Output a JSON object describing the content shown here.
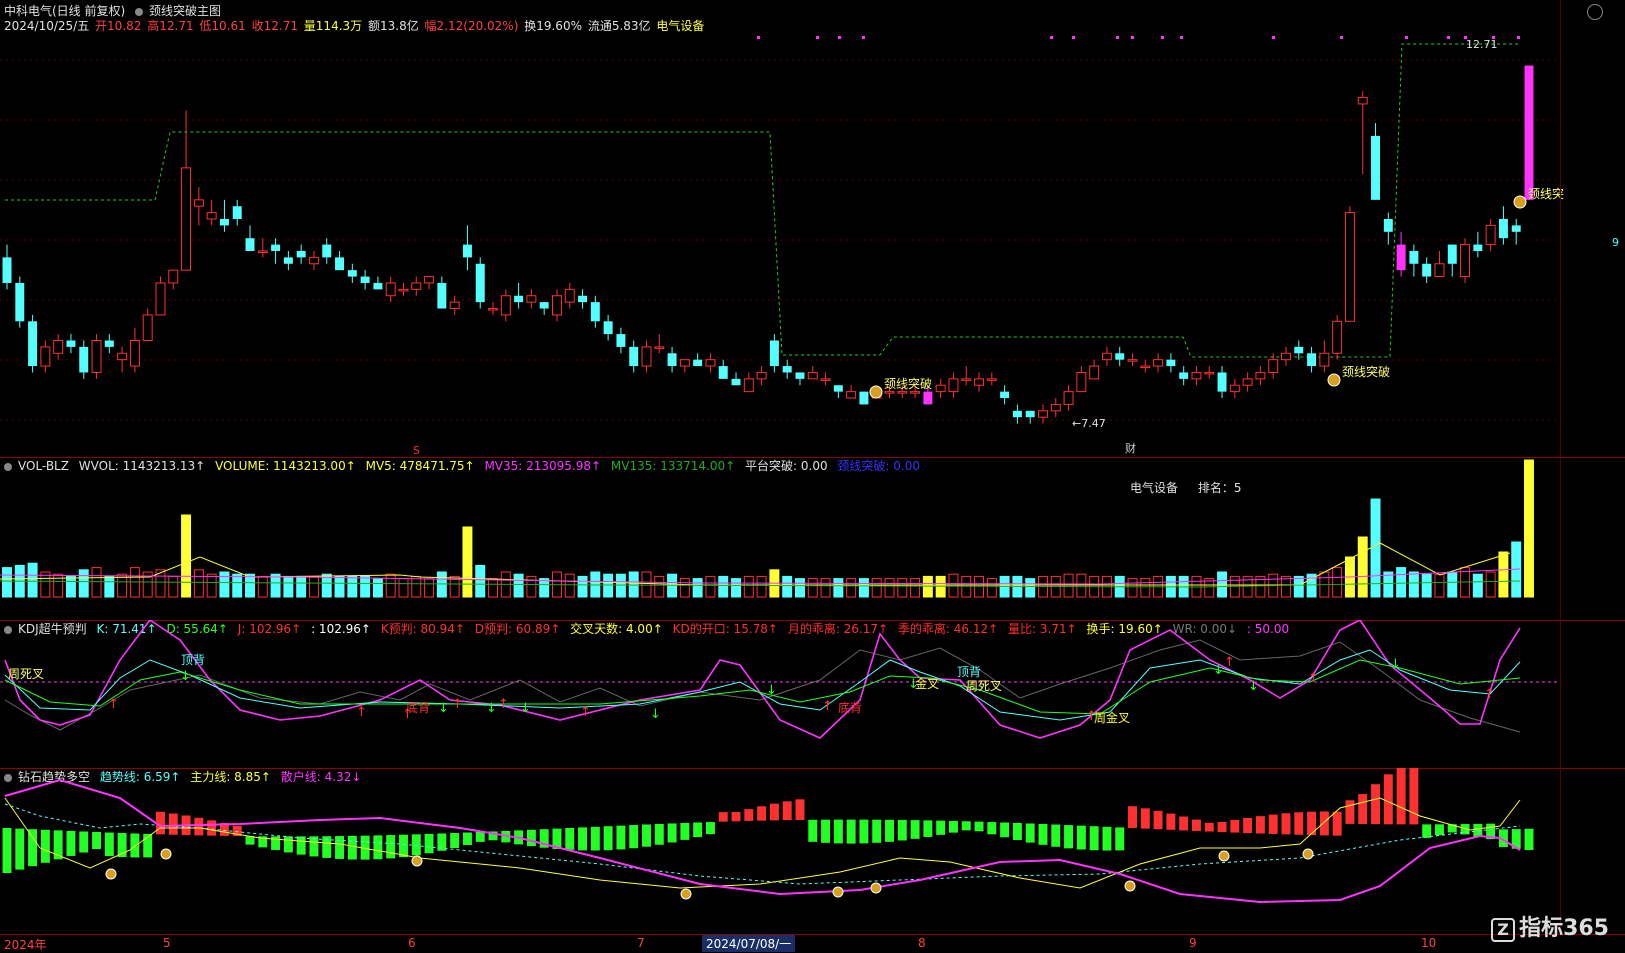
{
  "main": {
    "title": "中科电气(日线 前复权)",
    "indicator": "颈线突破主图",
    "info": {
      "date": "2024/10/25/五",
      "open": "开10.82",
      "high": "高12.71",
      "low": "低10.61",
      "close": "收12.71",
      "volume": "量114.3万",
      "amount": "额13.8亿",
      "change": "幅2.12(20.02%)",
      "turnover": "换19.60%",
      "float": "流通5.83亿",
      "industry": "电气设备"
    },
    "max_label": "12.71",
    "min_label": "←7.47",
    "signal_label": "颈线突破",
    "signal_label_short": "颈线突",
    "cai_label": "财",
    "s_label": "S",
    "right_edge_label": "9"
  },
  "volume": {
    "name": "VOL-BLZ",
    "wvol": "WVOL: 1143213.13↑",
    "volume": "VOLUME: 1143213.00↑",
    "mv5": "MV5: 478471.75↑",
    "mv35": "MV35: 213095.98↑",
    "mv135": "MV135: 133714.00↑",
    "platform": "平台突破: 0.00",
    "neck": "颈线突破: 0.00",
    "sector": "电气设备",
    "rank": "排名：5"
  },
  "kdj": {
    "name": "KDJ超牛预判",
    "k": "K: 71.41↑",
    "d": "D: 55.64↑",
    "j": "J: 102.96↑",
    "j2": ": 102.96↑",
    "kpred": "K预判: 80.94↑",
    "dpred": "D预判: 60.89↑",
    "cross_days": "交叉天数: 4.00↑",
    "kd_open": "KD的开口: 15.78↑",
    "month_dist": "月的乖离: 26.17↑",
    "season_dist": "季的乖离: 46.12↑",
    "vol_ratio": "量比: 3.71↑",
    "turnover": "换手: 19.60↑",
    "wr": "WR: 0.00↓",
    "fifty": ": 50.00",
    "labels": {
      "week_dead": "周死叉",
      "top_div": "顶背",
      "bottom_div": "底背",
      "golden": "金叉",
      "week_golden": "周金叉"
    }
  },
  "trend": {
    "name": "钻石趋势多空",
    "trend_line": "趋势线: 6.59↑",
    "main_line": "主力线: 8.85↑",
    "retail_line": "散户线: 4.32↓"
  },
  "xaxis": {
    "ticks": [
      "2024年",
      "5",
      "6",
      "7",
      "8",
      "9",
      "10"
    ],
    "selected": "2024/07/08/一"
  },
  "logo": "指标365",
  "colors": {
    "up": "#ff3030",
    "down": "#54ffff",
    "magenta": "#ff33ff",
    "yellow": "#ffff33",
    "green": "#22ff22",
    "neck": "#22cc22"
  },
  "chart_data": {
    "type": "candlestick",
    "ylim": [
      7.0,
      13.1
    ],
    "candles": [
      [
        9.7,
        9.3,
        9.9,
        9.2
      ],
      [
        9.3,
        8.7,
        9.4,
        8.6
      ],
      [
        8.7,
        8.0,
        8.8,
        7.9
      ],
      [
        8.0,
        8.3,
        8.4,
        7.9
      ],
      [
        8.2,
        8.4,
        8.5,
        8.1
      ],
      [
        8.4,
        8.3,
        8.5,
        8.2
      ],
      [
        8.3,
        7.9,
        8.4,
        7.8
      ],
      [
        7.9,
        8.4,
        8.5,
        7.8
      ],
      [
        8.4,
        8.3,
        8.5,
        8.2
      ],
      [
        8.1,
        8.2,
        8.3,
        7.9
      ],
      [
        8.0,
        8.4,
        8.6,
        7.9
      ],
      [
        8.4,
        8.8,
        8.9,
        8.4
      ],
      [
        8.8,
        9.3,
        9.4,
        8.8
      ],
      [
        9.3,
        9.5,
        9.5,
        9.2
      ],
      [
        9.5,
        11.1,
        12.0,
        10.4
      ],
      [
        10.5,
        10.6,
        10.8,
        10.2
      ],
      [
        10.3,
        10.4,
        10.6,
        10.2
      ],
      [
        10.3,
        10.2,
        10.6,
        10.1
      ],
      [
        10.5,
        10.3,
        10.6,
        10.2
      ],
      [
        10.0,
        9.8,
        10.2,
        9.8
      ],
      [
        9.8,
        9.8,
        10.0,
        9.7
      ],
      [
        9.9,
        9.8,
        10.0,
        9.6
      ],
      [
        9.7,
        9.6,
        9.8,
        9.5
      ],
      [
        9.8,
        9.7,
        9.9,
        9.6
      ],
      [
        9.6,
        9.7,
        9.8,
        9.5
      ],
      [
        9.9,
        9.7,
        10.0,
        9.6
      ],
      [
        9.7,
        9.5,
        9.8,
        9.5
      ],
      [
        9.5,
        9.4,
        9.6,
        9.3
      ],
      [
        9.4,
        9.3,
        9.5,
        9.2
      ],
      [
        9.3,
        9.2,
        9.4,
        9.2
      ],
      [
        9.1,
        9.3,
        9.4,
        9.0
      ],
      [
        9.2,
        9.2,
        9.3,
        9.1
      ],
      [
        9.2,
        9.3,
        9.4,
        9.1
      ],
      [
        9.3,
        9.4,
        9.4,
        9.2
      ],
      [
        9.3,
        8.9,
        9.4,
        8.9
      ],
      [
        8.9,
        9.0,
        9.1,
        8.8
      ],
      [
        9.9,
        9.7,
        10.2,
        9.5
      ],
      [
        9.6,
        9.0,
        9.7,
        8.9
      ],
      [
        8.9,
        8.9,
        9.0,
        8.8
      ],
      [
        8.8,
        9.1,
        9.2,
        8.7
      ],
      [
        9.1,
        9.0,
        9.3,
        8.9
      ],
      [
        9.0,
        9.1,
        9.2,
        8.9
      ],
      [
        9.0,
        8.9,
        9.0,
        8.8
      ],
      [
        8.8,
        9.1,
        9.2,
        8.7
      ],
      [
        9.0,
        9.2,
        9.3,
        8.9
      ],
      [
        9.1,
        9.0,
        9.2,
        8.9
      ],
      [
        9.0,
        8.7,
        9.1,
        8.6
      ],
      [
        8.7,
        8.5,
        8.8,
        8.4
      ],
      [
        8.5,
        8.3,
        8.6,
        8.2
      ],
      [
        8.3,
        8.0,
        8.4,
        7.9
      ],
      [
        8.0,
        8.3,
        8.4,
        7.9
      ],
      [
        8.3,
        8.3,
        8.5,
        8.2
      ],
      [
        8.2,
        8.0,
        8.3,
        7.9
      ],
      [
        8.0,
        8.1,
        8.1,
        7.9
      ],
      [
        8.1,
        8.0,
        8.2,
        8.0
      ],
      [
        8.0,
        8.1,
        8.2,
        7.9
      ],
      [
        8.0,
        7.8,
        8.1,
        7.8
      ],
      [
        7.8,
        7.7,
        7.9,
        7.7
      ],
      [
        7.6,
        7.8,
        7.9,
        7.6
      ],
      [
        7.8,
        7.9,
        8.0,
        7.7
      ],
      [
        8.4,
        8.0,
        8.5,
        7.9
      ],
      [
        8.0,
        7.9,
        8.1,
        7.8
      ],
      [
        7.9,
        7.8,
        7.9,
        7.7
      ],
      [
        7.8,
        7.9,
        8.0,
        7.8
      ],
      [
        7.8,
        7.8,
        7.9,
        7.7
      ],
      [
        7.7,
        7.6,
        7.7,
        7.5
      ],
      [
        7.5,
        7.6,
        7.7,
        7.5
      ],
      [
        7.6,
        7.4,
        7.6,
        7.4
      ],
      [
        7.5,
        7.6,
        7.7,
        7.5
      ],
      [
        7.6,
        7.6,
        7.7,
        7.5
      ],
      [
        7.6,
        7.6,
        7.7,
        7.5
      ],
      [
        7.6,
        7.6,
        7.7,
        7.5
      ],
      [
        7.4,
        7.6,
        7.7,
        7.4
      ],
      [
        7.6,
        7.7,
        7.8,
        7.5
      ],
      [
        7.6,
        7.8,
        7.9,
        7.5
      ],
      [
        7.8,
        7.8,
        8.0,
        7.7
      ],
      [
        7.7,
        7.8,
        7.9,
        7.6
      ],
      [
        7.8,
        7.8,
        7.9,
        7.7
      ],
      [
        7.6,
        7.5,
        7.7,
        7.4
      ],
      [
        7.3,
        7.2,
        7.4,
        7.1
      ],
      [
        7.3,
        7.2,
        7.3,
        7.1
      ],
      [
        7.2,
        7.3,
        7.4,
        7.1
      ],
      [
        7.3,
        7.4,
        7.5,
        7.2
      ],
      [
        7.4,
        7.6,
        7.7,
        7.3
      ],
      [
        7.6,
        7.9,
        8.0,
        7.6
      ],
      [
        7.8,
        8.0,
        8.1,
        7.8
      ],
      [
        8.1,
        8.2,
        8.3,
        8.0
      ],
      [
        8.2,
        8.1,
        8.3,
        8.0
      ],
      [
        8.1,
        8.1,
        8.2,
        8.0
      ],
      [
        8.0,
        8.0,
        8.1,
        7.9
      ],
      [
        8.0,
        8.1,
        8.2,
        7.9
      ],
      [
        8.1,
        8.0,
        8.2,
        7.9
      ],
      [
        7.9,
        7.8,
        8.0,
        7.7
      ],
      [
        7.8,
        7.9,
        8.0,
        7.7
      ],
      [
        7.9,
        7.9,
        8.0,
        7.8
      ],
      [
        7.9,
        7.6,
        8.0,
        7.5
      ],
      [
        7.6,
        7.7,
        7.8,
        7.5
      ],
      [
        7.7,
        7.8,
        7.9,
        7.6
      ],
      [
        7.8,
        7.9,
        8.0,
        7.7
      ],
      [
        7.9,
        8.1,
        8.2,
        7.8
      ],
      [
        8.1,
        8.2,
        8.3,
        8.0
      ],
      [
        8.3,
        8.2,
        8.4,
        8.1
      ],
      [
        8.2,
        8.0,
        8.3,
        7.9
      ],
      [
        8.0,
        8.2,
        8.4,
        7.9
      ],
      [
        8.2,
        8.7,
        8.8,
        8.1
      ],
      [
        8.7,
        10.4,
        10.5,
        8.7
      ],
      [
        12.1,
        12.2,
        12.3,
        11.0
      ],
      [
        11.6,
        10.6,
        11.8,
        10.6
      ],
      [
        10.3,
        10.1,
        10.4,
        9.9
      ],
      [
        9.9,
        9.5,
        10.1,
        9.4
      ],
      [
        9.8,
        9.6,
        9.9,
        9.4
      ],
      [
        9.6,
        9.4,
        9.7,
        9.3
      ],
      [
        9.4,
        9.6,
        9.8,
        9.4
      ],
      [
        9.9,
        9.6,
        9.9,
        9.4
      ],
      [
        9.4,
        9.9,
        10.0,
        9.3
      ],
      [
        9.9,
        9.8,
        10.1,
        9.7
      ],
      [
        9.9,
        10.2,
        10.3,
        9.8
      ],
      [
        10.3,
        10.0,
        10.5,
        9.9
      ],
      [
        10.2,
        10.1,
        10.3,
        9.9
      ],
      [
        10.6,
        12.7,
        12.7,
        10.6
      ]
    ]
  }
}
